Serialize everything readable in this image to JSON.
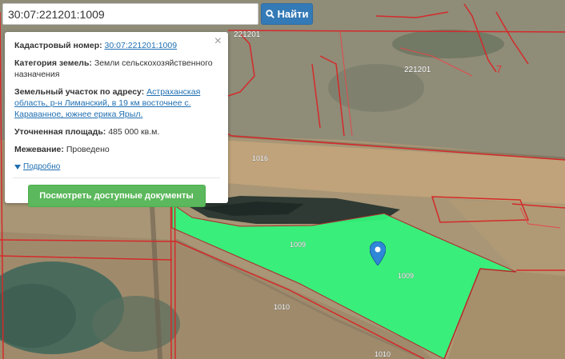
{
  "search": {
    "value": "30:07:221201:1009",
    "button_label": "Найти"
  },
  "popup": {
    "cadastral_label": "Кадастровый номер:",
    "cadastral_value": "30:07:221201:1009",
    "category_label": "Категория земель:",
    "category_value": "Земли сельскохозяйственного назначения",
    "address_label": "Земельный участок по адресу:",
    "address_value": "Астраханская область, р-н Лиманский, в 19 км восточнее с. Караванное, южнее ерика Ярыл.",
    "area_label": "Уточненная площадь:",
    "area_value": "485 000 кв.м.",
    "survey_label": "Межевание:",
    "survey_value": "Проведено",
    "details_label": "Подробно",
    "docs_button": "Посмотреть доступные документы"
  },
  "map_labels": {
    "quarter_top": "221201",
    "quarter_right": "221201",
    "plot_number_7": "7",
    "road_1016": "1016",
    "parcel_1009_a": "1009",
    "parcel_1009_b": "1009",
    "road_1010_a": "1010",
    "road_1010_b": "1010"
  },
  "colors": {
    "parcel_fill": "#33f27a",
    "boundary": "#d42a2a",
    "search_button": "#337ab7",
    "docs_button": "#5cb85c",
    "link": "#1f6fb2"
  },
  "icons": [
    "search-icon",
    "close-icon",
    "caret-down-icon",
    "location-pin-icon"
  ]
}
